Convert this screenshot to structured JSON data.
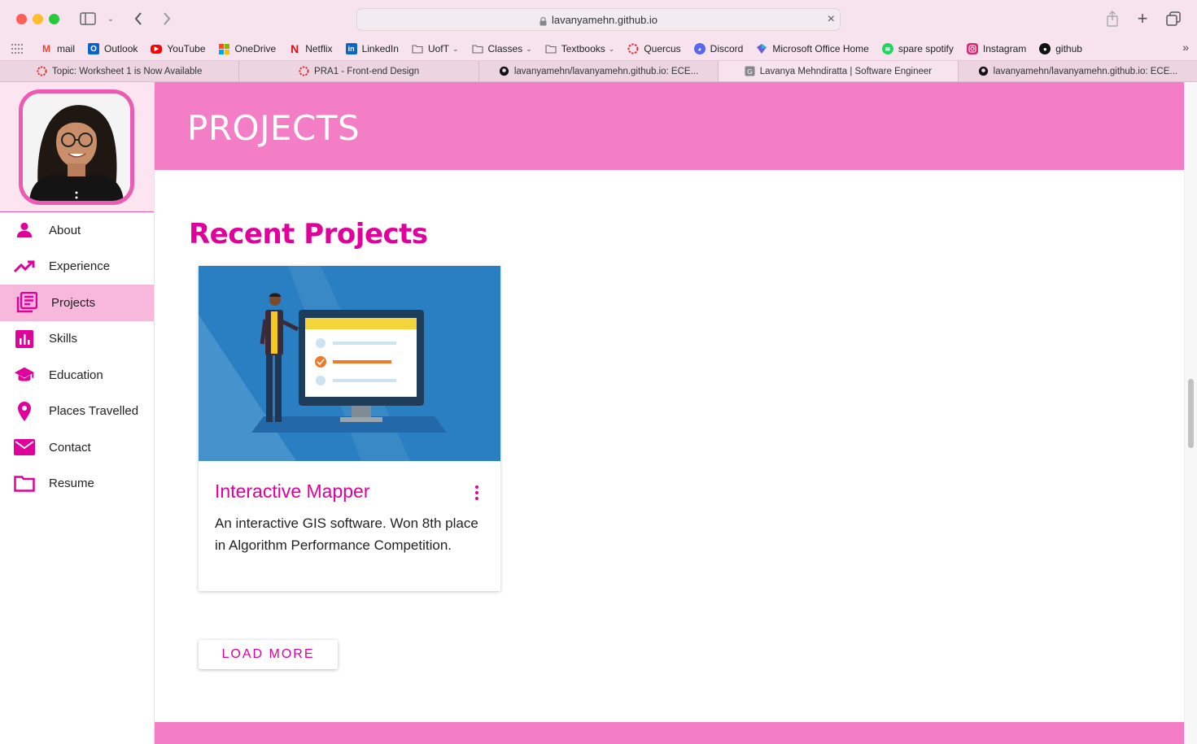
{
  "browser": {
    "url": "lavanyamehn.github.io",
    "bookmarks": [
      {
        "label": "mail",
        "icon": "gmail-icon",
        "color": "#ea4335"
      },
      {
        "label": "Outlook",
        "icon": "outlook-icon",
        "color": "#0a64c9"
      },
      {
        "label": "YouTube",
        "icon": "youtube-icon",
        "color": "#ff0000"
      },
      {
        "label": "OneDrive",
        "icon": "microsoft-icon",
        "color": "#f25022"
      },
      {
        "label": "Netflix",
        "icon": "netflix-icon",
        "color": "#e50914"
      },
      {
        "label": "LinkedIn",
        "icon": "linkedin-icon",
        "color": "#0a66c2"
      },
      {
        "label": "UofT",
        "icon": "folder-icon",
        "folder": true
      },
      {
        "label": "Classes",
        "icon": "folder-icon",
        "folder": true
      },
      {
        "label": "Textbooks",
        "icon": "folder-icon",
        "folder": true
      },
      {
        "label": "Quercus",
        "icon": "quercus-icon",
        "color": "#d32f2f"
      },
      {
        "label": "Discord",
        "icon": "discord-icon",
        "color": "#5865f2"
      },
      {
        "label": "Microsoft Office Home",
        "icon": "office-icon",
        "color": "#6b5ed6"
      },
      {
        "label": "spare spotify",
        "icon": "spotify-icon",
        "color": "#1ed760"
      },
      {
        "label": "Instagram",
        "icon": "instagram-icon",
        "color": "#d62976"
      },
      {
        "label": "github",
        "icon": "github-icon",
        "color": "#111111"
      }
    ],
    "tabs": [
      {
        "label": "Topic: Worksheet 1 is Now Available",
        "icon": "quercus-icon",
        "active": false
      },
      {
        "label": "PRA1 - Front-end Design",
        "icon": "quercus-icon",
        "active": false
      },
      {
        "label": "lavanyamehn/lavanyamehn.github.io: ECE...",
        "icon": "github-icon",
        "active": false
      },
      {
        "label": "Lavanya Mehndiratta | Software Engineer",
        "icon": "site-icon",
        "active": true
      },
      {
        "label": "lavanyamehn/lavanyamehn.github.io: ECE...",
        "icon": "github-icon",
        "active": false
      }
    ]
  },
  "sidebar": {
    "items": [
      {
        "label": "About",
        "icon": "person-icon"
      },
      {
        "label": "Experience",
        "icon": "trending-up-icon"
      },
      {
        "label": "Projects",
        "icon": "library-books-icon",
        "active": true
      },
      {
        "label": "Skills",
        "icon": "bar-chart-icon"
      },
      {
        "label": "Education",
        "icon": "school-icon"
      },
      {
        "label": "Places Travelled",
        "icon": "location-pin-icon"
      },
      {
        "label": "Contact",
        "icon": "mail-icon"
      },
      {
        "label": "Resume",
        "icon": "folder-icon"
      }
    ]
  },
  "page": {
    "header_title": "PROJECTS",
    "section_title": "Recent Projects",
    "card": {
      "title": "Interactive Mapper",
      "description": "An interactive GIS software. Won 8th place in Algorithm Performance Competition."
    },
    "load_more": "LOAD MORE"
  },
  "colors": {
    "accent": "#e0009a",
    "header_pink": "#f37ec6",
    "active_nav": "#f7b8dc",
    "chrome": "#f7e3ee"
  }
}
